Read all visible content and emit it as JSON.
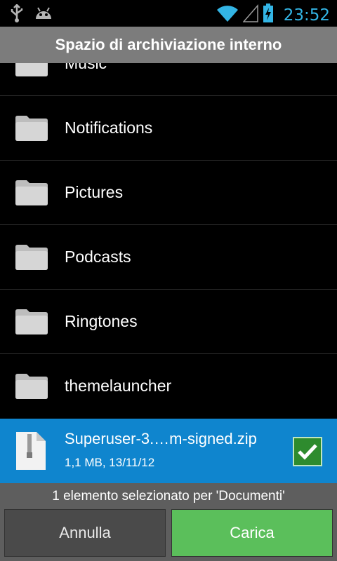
{
  "status_bar": {
    "icons_left": [
      "usb-icon",
      "android-debug-icon"
    ],
    "icons_right": [
      "wifi-icon",
      "signal-icon",
      "battery-charging-icon"
    ],
    "time": "23:52",
    "time_color": "#33b5e5"
  },
  "title": "Spazio di archiviazione interno",
  "folders": [
    {
      "label": "Music"
    },
    {
      "label": "Notifications"
    },
    {
      "label": "Pictures"
    },
    {
      "label": "Podcasts"
    },
    {
      "label": "Ringtones"
    },
    {
      "label": "themelauncher"
    }
  ],
  "selected_file": {
    "name": "Superuser-3.…m-signed.zip",
    "meta": "1,1 MB, 13/11/12",
    "checked": true,
    "highlight_color": "#0f85ce"
  },
  "footer": {
    "info": "1 elemento selezionato per 'Documenti'",
    "cancel_label": "Annulla",
    "confirm_label": "Carica",
    "confirm_color": "#5bbf5b"
  }
}
